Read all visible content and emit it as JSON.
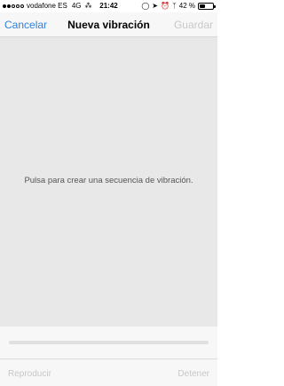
{
  "status_bar": {
    "carrier": "vodafone ES",
    "network": "4G",
    "activity": "⁂",
    "time": "21:42",
    "battery_text": "42 %",
    "battery_level": 0.42
  },
  "nav": {
    "cancel_label": "Cancelar",
    "title": "Nueva vibración",
    "save_label": "Guardar"
  },
  "canvas": {
    "hint": "Pulsa para crear una secuencia de vibración."
  },
  "controls": {
    "play_label": "Reproducir",
    "stop_label": "Detener",
    "progress": 0
  },
  "colors": {
    "accent": "#2f7fd9",
    "disabled": "#c8c8c8",
    "canvas_bg": "#e8e8e8"
  }
}
